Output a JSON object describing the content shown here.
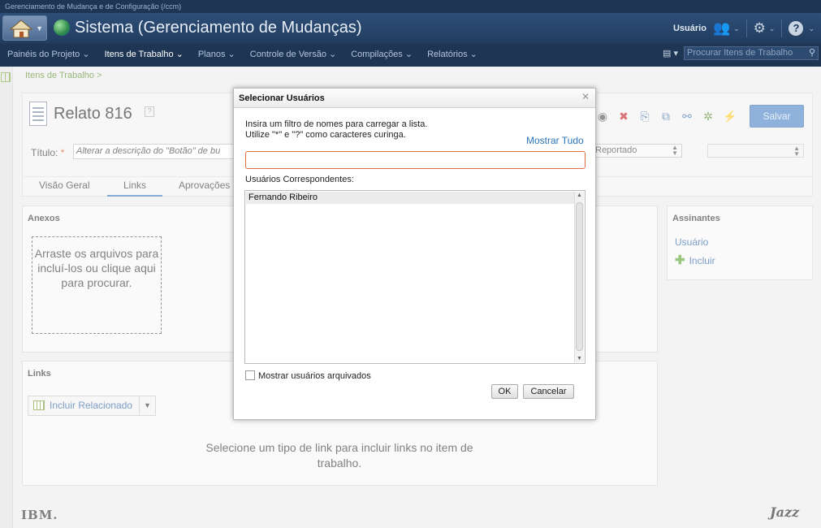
{
  "app_caption": "Gerenciamento de Mudança e de Configuração (/ccm)",
  "header": {
    "title": "Sistema (Gerenciamento de Mudanças)",
    "user_label": "Usuário",
    "icons": {
      "home": "home-icon",
      "globe": "globe-icon",
      "users": "users-icon",
      "settings": "gear-icon",
      "help": "help-icon"
    }
  },
  "nav": {
    "items": [
      {
        "label": "Painéis do Projeto ⌄"
      },
      {
        "label": "Itens de Trabalho ⌄"
      },
      {
        "label": "Planos ⌄"
      },
      {
        "label": "Controle de Versão ⌄"
      },
      {
        "label": "Compilações ⌄"
      },
      {
        "label": "Relatórios ⌄"
      }
    ],
    "search_placeholder": "Procurar Itens de Trabalho"
  },
  "breadcrumb": "Itens de Trabalho >",
  "work_item": {
    "title": "Relato 816",
    "title_field_label": "Título:",
    "title_required": "*",
    "title_value": "Alterar a descrição do \"Botão\" de bu",
    "state": "Reportado",
    "save_label": "Salvar",
    "tabs": [
      {
        "label": "Visão Geral"
      },
      {
        "label": "Links"
      },
      {
        "label": "Aprovações"
      }
    ],
    "active_tab": "Links"
  },
  "attachments": {
    "title": "Anexos",
    "dropzone_text": "Arraste os arquivos para incluí-los ou clique aqui para procurar."
  },
  "links": {
    "title": "Links",
    "include_related_label": "Incluir Relacionado",
    "message": "Selecione um tipo de link para incluir links no item de trabalho."
  },
  "subscribers": {
    "title": "Assinantes",
    "user_link": "Usuário",
    "include_label": "Incluir"
  },
  "footer": {
    "left_logo": "IBM.",
    "right_logo": "Jazz"
  },
  "dialog": {
    "title": "Selecionar Usuários",
    "instructions_line1": "Insira um filtro de nomes para carregar a lista.",
    "instructions_line2": "Utilize \"*\" e \"?\" como caracteres curinga.",
    "show_all": "Mostrar Tudo",
    "filter_value": "",
    "matching_label": "Usuários Correspondentes:",
    "matching_users": [
      "Fernando Ribeiro"
    ],
    "show_archived_label": "Mostrar usuários arquivados",
    "ok_label": "OK",
    "cancel_label": "Cancelar"
  },
  "colors": {
    "header_bg": "#1e3553",
    "accent_link": "#2a74b8",
    "save_button": "#4a84c6",
    "filter_focus": "#e06b3c"
  }
}
